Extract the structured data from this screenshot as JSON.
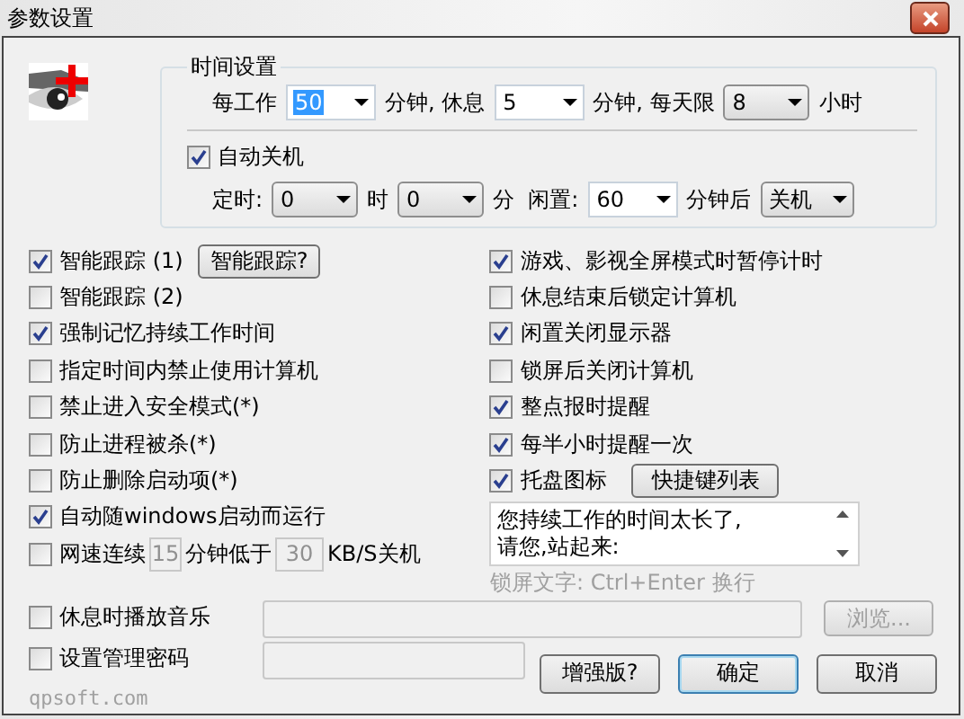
{
  "window": {
    "title": "参数设置"
  },
  "time_settings": {
    "title": "时间设置",
    "work_row": [
      {
        "kind": "text",
        "text": "每工作"
      },
      {
        "kind": "combo",
        "value": "50",
        "editable": true,
        "highlighted": true
      },
      {
        "kind": "text",
        "text": "分钟, 休息"
      },
      {
        "kind": "combo",
        "value": "5",
        "editable": true,
        "highlighted": false
      },
      {
        "kind": "text",
        "text": "分钟, 每天限"
      },
      {
        "kind": "combo",
        "value": "8",
        "editable": false,
        "highlighted": false
      },
      {
        "kind": "text",
        "text": "小时"
      }
    ],
    "auto_shutdown": {
      "label": "自动关机",
      "checked": true
    },
    "shutdown_row": [
      {
        "kind": "text",
        "text": "定时:"
      },
      {
        "kind": "combo",
        "value": "0",
        "editable": false,
        "highlighted": false
      },
      {
        "kind": "text",
        "text": "时"
      },
      {
        "kind": "combo",
        "value": "0",
        "editable": false,
        "highlighted": false
      },
      {
        "kind": "text",
        "text": "分  闲置:"
      },
      {
        "kind": "combo",
        "value": "60",
        "editable": true,
        "highlighted": false
      },
      {
        "kind": "text",
        "text": "分钟后"
      },
      {
        "kind": "combo",
        "value": "关机",
        "editable": false,
        "highlighted": false
      }
    ]
  },
  "left_options": [
    {
      "kind": "check",
      "label": "智能跟踪 (1)",
      "checked": true,
      "button": "智能跟踪?"
    },
    {
      "kind": "check",
      "label": "智能跟踪 (2)",
      "checked": false
    },
    {
      "kind": "check",
      "label": "强制记忆持续工作时间",
      "checked": true
    },
    {
      "kind": "check",
      "label": "指定时间内禁止使用计算机",
      "checked": false
    },
    {
      "kind": "check",
      "label": "禁止进入安全模式(*)",
      "checked": false
    },
    {
      "kind": "check",
      "label": "防止进程被杀(*)",
      "checked": false
    },
    {
      "kind": "check",
      "label": "防止删除启动项(*)",
      "checked": false
    },
    {
      "kind": "check",
      "label": "自动随windows启动而运行",
      "checked": true
    },
    {
      "kind": "speed",
      "label": "网速连续",
      "checked": false,
      "minutes": "15",
      "middle": "分钟低于",
      "rate": "30",
      "unit": "KB/S关机"
    }
  ],
  "right_options": [
    {
      "label": "游戏、影视全屏模式时暂停计时",
      "checked": true
    },
    {
      "label": "休息结束后锁定计算机",
      "checked": false
    },
    {
      "label": "闲置关闭显示器",
      "checked": true
    },
    {
      "label": "锁屏后关闭计算机",
      "checked": false
    },
    {
      "label": "整点报时提醒",
      "checked": true
    },
    {
      "label": "每半小时提醒一次",
      "checked": true
    },
    {
      "label": "托盘图标",
      "checked": true,
      "button": "快捷键列表"
    }
  ],
  "lock_text": {
    "value": "您持续工作的时间太长了,\n请您,站起来:",
    "caption": "锁屏文字: Ctrl+Enter 换行"
  },
  "music": {
    "label": "休息时播放音乐",
    "checked": false,
    "browse": "浏览...",
    "browse_disabled": true
  },
  "password": {
    "label": "设置管理密码",
    "checked": false
  },
  "site": "qpsoft.com",
  "buttons": [
    {
      "label": "增强版?",
      "default": false
    },
    {
      "label": "确定",
      "default": true
    },
    {
      "label": "取消",
      "default": false
    }
  ]
}
